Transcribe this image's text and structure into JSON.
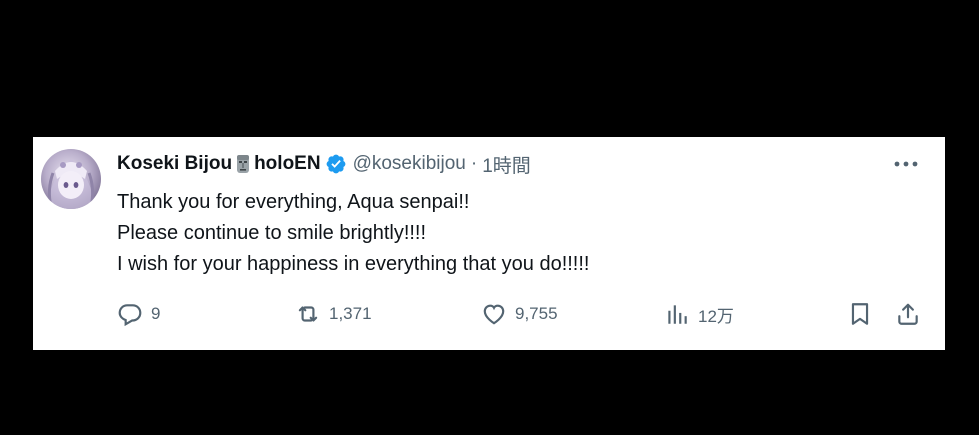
{
  "tweet": {
    "author": {
      "display_name": "Koseki Bijou",
      "org": "holoEN",
      "handle": "@kosekibijou",
      "verified": true
    },
    "separator": "·",
    "time": "1時間",
    "lines": [
      "Thank you for everything, Aqua senpai!!",
      "Please continue to smile brightly!!!!",
      "I wish for your happiness in everything that you do!!!!!"
    ],
    "actions": {
      "replies": "9",
      "reposts": "1,371",
      "likes": "9,755",
      "views": "12万"
    }
  },
  "icons": {
    "verified": "verified-badge-icon",
    "moai": "moai-emoji-icon",
    "more": "more-dots-icon",
    "reply": "reply-bubble-icon",
    "repost": "repost-arrows-icon",
    "like": "heart-icon",
    "views": "bar-chart-icon",
    "bookmark": "bookmark-icon",
    "share": "share-upload-icon"
  },
  "colors": {
    "background": "#000000",
    "card": "#ffffff",
    "text": "#0f1419",
    "secondary": "#536471",
    "verified": "#1d9bf0"
  }
}
